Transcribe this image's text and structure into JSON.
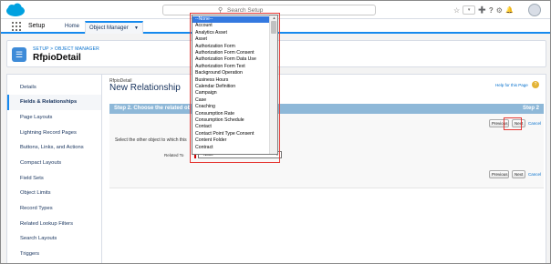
{
  "header": {
    "search_placeholder": "Search Setup",
    "icons": [
      "star-icon",
      "chevron-down-icon",
      "add-icon",
      "help-icon",
      "gear-icon",
      "bell-icon",
      "avatar"
    ],
    "glyphs": {
      "star": "☆",
      "fav_arrow": "▾",
      "add": "➕",
      "help": "?",
      "gear": "⚙",
      "bell": "🔔"
    }
  },
  "appnav": {
    "app_name": "Setup",
    "tabs": [
      {
        "label": "Home"
      },
      {
        "label": "Object Manager"
      }
    ]
  },
  "object": {
    "breadcrumb": "SETUP > OBJECT MANAGER",
    "title": "RfpioDetail"
  },
  "sidebar": {
    "items": [
      {
        "label": "Details",
        "active": false
      },
      {
        "label": "Fields & Relationships",
        "active": true
      },
      {
        "label": "Page Layouts",
        "active": false
      },
      {
        "label": "Lightning Record Pages",
        "active": false
      },
      {
        "label": "Buttons, Links, and Actions",
        "active": false
      },
      {
        "label": "Compact Layouts",
        "active": false
      },
      {
        "label": "Field Sets",
        "active": false
      },
      {
        "label": "Object Limits",
        "active": false
      },
      {
        "label": "Record Types",
        "active": false
      },
      {
        "label": "Related Lookup Filters",
        "active": false
      },
      {
        "label": "Search Layouts",
        "active": false
      },
      {
        "label": "Triggers",
        "active": false
      }
    ]
  },
  "content": {
    "subcrumb": "RfpioDetail",
    "page_title": "New Relationship",
    "help_link": "Help for this Page",
    "step_title": "Step 2. Choose the related ob",
    "step_number": "Step 2",
    "instruction": "Select the other object to which this",
    "related_to_label": "Related To",
    "related_to_value": "--None--",
    "buttons": {
      "previous": "Previous",
      "next": "Next",
      "cancel": "Cancel"
    }
  },
  "dropdown": {
    "options": [
      "--None--",
      "Account",
      "Analytics Asset",
      "Asset",
      "Authorization Form",
      "Authorization Form Consent",
      "Authorization Form Data Use",
      "Authorization Form Text",
      "Background Operation",
      "Business Hours",
      "Calendar Definition",
      "Campaign",
      "Case",
      "Coaching",
      "Consumption Rate",
      "Consumption Schedule",
      "Contact",
      "Contact Point Type Consent",
      "Content Folder",
      "Contract"
    ],
    "selected_index": 0
  },
  "colors": {
    "accent": "#1589ee",
    "step_bar": "#8eb8d8",
    "annotation_red": "#e53935",
    "selected_option": "#3479e0"
  }
}
